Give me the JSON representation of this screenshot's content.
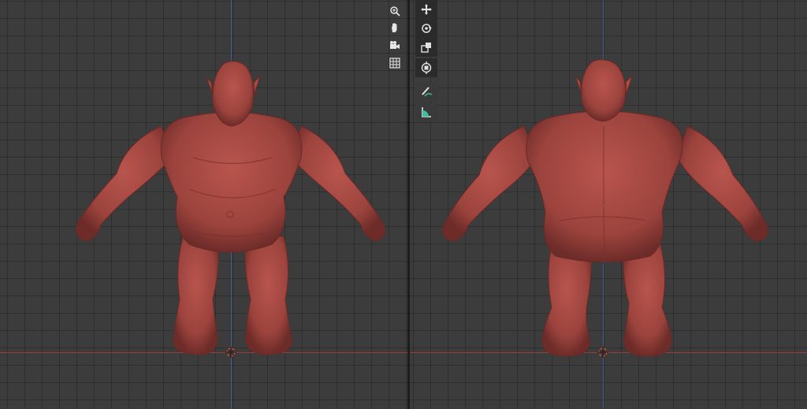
{
  "app": {
    "accent": "#e2e2e2",
    "axis_x_color": "#9a3b3b",
    "axis_z_color": "#3f5d9a",
    "model_color": "#a64a44"
  },
  "navigation_gizmo": {
    "items": [
      {
        "name": "zoom-icon"
      },
      {
        "name": "pan-hand-icon"
      },
      {
        "name": "camera-icon"
      },
      {
        "name": "ortho-grid-icon"
      }
    ]
  },
  "tool_shelf": {
    "items": [
      {
        "name": "move-tool-icon"
      },
      {
        "name": "rotate-tool-icon"
      },
      {
        "name": "scale-tool-icon"
      },
      {
        "name": "transform-tool-icon"
      },
      {
        "name": "annotate-tool-icon"
      },
      {
        "name": "measure-tool-icon"
      }
    ]
  },
  "viewports": [
    {
      "label": "front-view"
    },
    {
      "label": "back-view"
    }
  ]
}
